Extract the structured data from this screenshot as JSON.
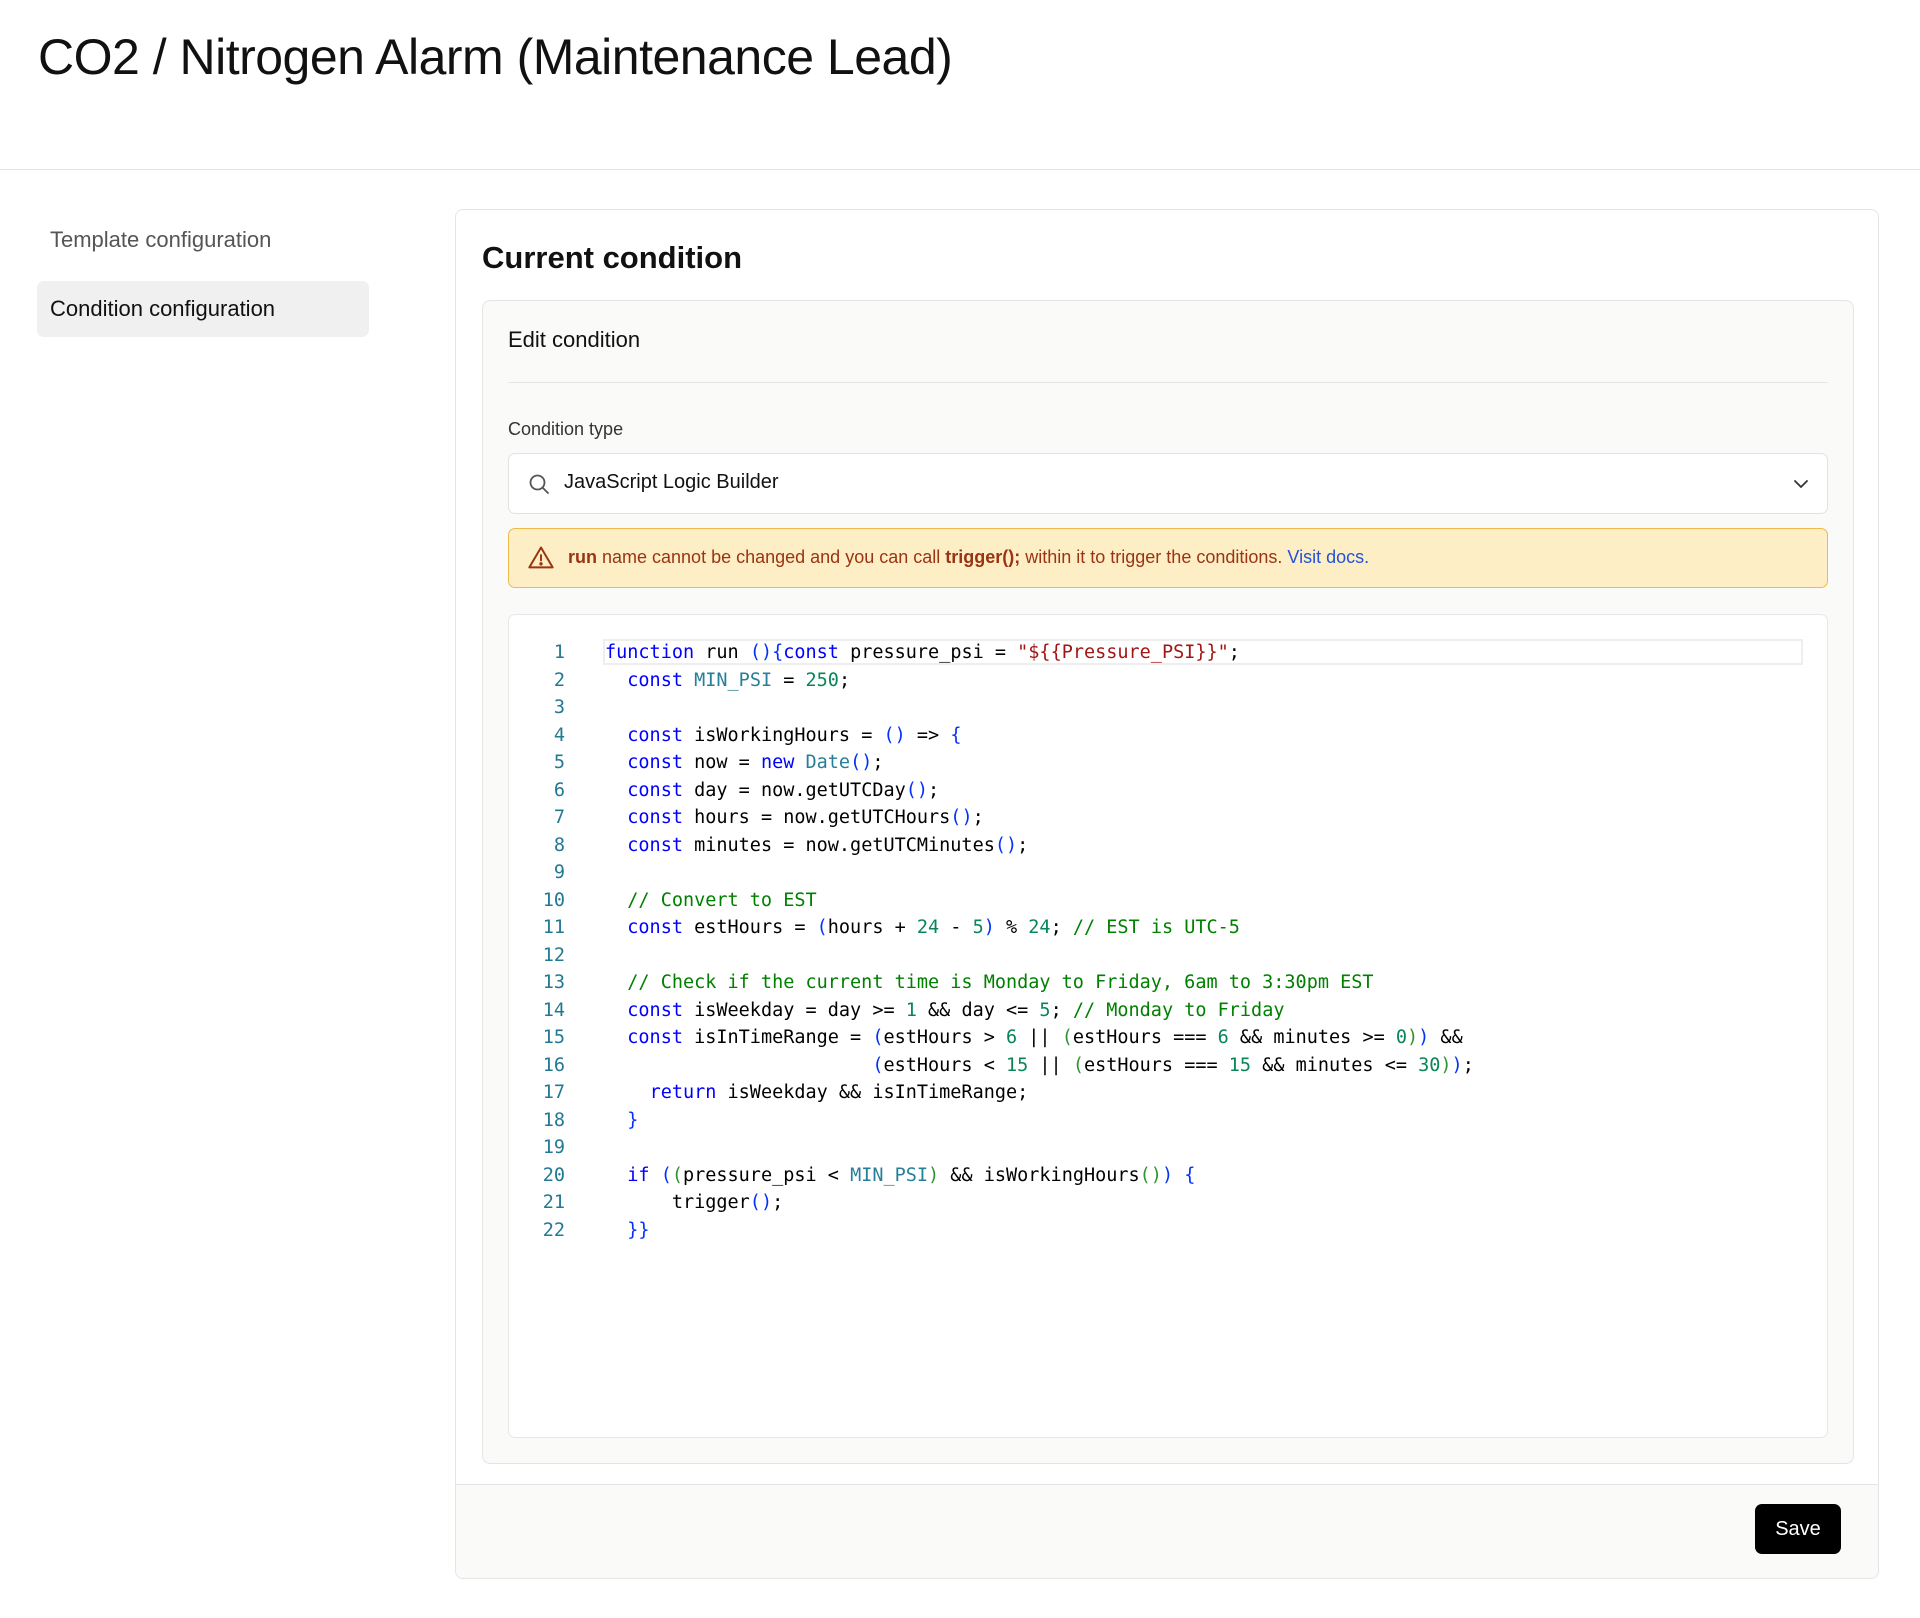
{
  "page": {
    "title": "CO2 / Nitrogen Alarm (Maintenance Lead)"
  },
  "sidebar": {
    "items": [
      {
        "label": "Template configuration",
        "active": false
      },
      {
        "label": "Condition configuration",
        "active": true
      }
    ]
  },
  "panel": {
    "title": "Current condition",
    "edit_header": "Edit condition",
    "condition_type": {
      "label": "Condition type",
      "value": "JavaScript Logic Builder",
      "icon": "search-icon",
      "chevron": "chevron-down-icon"
    },
    "alert": {
      "icon": "warning-triangle-icon",
      "run_kw": "run",
      "text1": " name cannot be changed and you can call ",
      "trigger_kw": "trigger();",
      "text2": " within it to trigger the conditions. ",
      "link": "Visit docs",
      "period": "."
    },
    "save_label": "Save"
  },
  "code": {
    "line_numbers": [
      "1",
      "2",
      "3",
      "4",
      "5",
      "6",
      "7",
      "8",
      "9",
      "10",
      "11",
      "12",
      "13",
      "14",
      "15",
      "16",
      "17",
      "18",
      "19",
      "20",
      "21",
      "22"
    ],
    "lines": [
      "function run (){const pressure_psi = \"${{Pressure_PSI}}\";",
      "  const MIN_PSI = 250;",
      "",
      "  const isWorkingHours = () => {",
      "  const now = new Date();",
      "  const day = now.getUTCDay();",
      "  const hours = now.getUTCHours();",
      "  const minutes = now.getUTCMinutes();",
      "",
      "  // Convert to EST",
      "  const estHours = (hours + 24 - 5) % 24; // EST is UTC-5",
      "",
      "  // Check if the current time is Monday to Friday, 6am to 3:30pm EST",
      "  const isWeekday = day >= 1 && day <= 5; // Monday to Friday",
      "  const isInTimeRange = (estHours > 6 || (estHours === 6 && minutes >= 0)) &&",
      "                        (estHours < 15 || (estHours === 15 && minutes <= 30));",
      "    return isWeekday && isInTimeRange;",
      "  }",
      "",
      "  if ((pressure_psi < MIN_PSI) && isWorkingHours()) {",
      "      trigger();",
      "  }}"
    ]
  },
  "colors": {
    "alert_bg": "#fdeec5",
    "alert_border": "#f0b94a",
    "alert_text": "#9a3412",
    "link": "#2352d6",
    "save_bg": "#000000",
    "line_number": "#237893",
    "keyword": "#0000ff",
    "comment": "#008000",
    "number": "#098658",
    "string": "#a31515"
  }
}
